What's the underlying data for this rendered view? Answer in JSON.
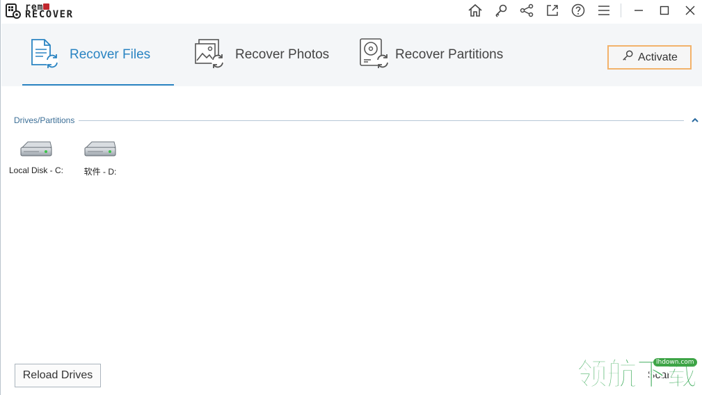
{
  "app": {
    "logo_line1": "rem",
    "logo_line2": "RECOVER"
  },
  "titlebar": {
    "icons": [
      "home-icon",
      "key-icon",
      "share-icon",
      "external-link-icon",
      "help-icon",
      "menu-icon",
      "minimize-icon",
      "maximize-icon",
      "close-icon"
    ]
  },
  "tabs": [
    {
      "label": "Recover Files",
      "icon": "recover-files-icon",
      "active": true
    },
    {
      "label": "Recover Photos",
      "icon": "recover-photos-icon",
      "active": false
    },
    {
      "label": "Recover Partitions",
      "icon": "recover-partitions-icon",
      "active": false
    }
  ],
  "activate": {
    "label": "Activate"
  },
  "section": {
    "title": "Drives/Partitions"
  },
  "drives": [
    {
      "label": "Local Disk - C:"
    },
    {
      "label": "软件 - D:"
    }
  ],
  "footer": {
    "reload_label": "Reload Drives",
    "scan_label": "Scan"
  },
  "watermark": {
    "text": "领航下载",
    "badge": "lhdown.com"
  },
  "colors": {
    "accent": "#2a84c2",
    "activate_border": "#f2b26a",
    "logo_red": "#c0272d",
    "watermark_green": "#2aa44a"
  }
}
